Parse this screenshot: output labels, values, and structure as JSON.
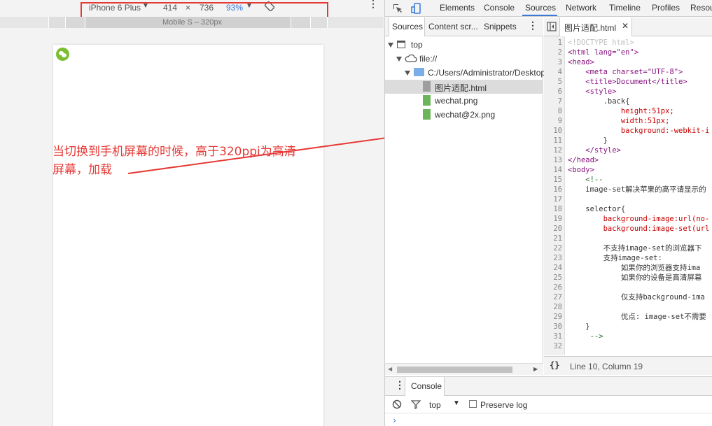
{
  "device_toolbar": {
    "device_name": "iPhone 6 Plus",
    "width": "414",
    "times": "×",
    "height": "736",
    "zoom": "93%"
  },
  "media_query_bar": {
    "label": "Mobile S – 320px"
  },
  "annotation": {
    "line1": "当切换到手机屏幕的时候，高于320ppi为高清",
    "line2": "屏幕，加载"
  },
  "devtools_tabs": [
    "Elements",
    "Console",
    "Sources",
    "Network",
    "Timeline",
    "Profiles",
    "Resou"
  ],
  "active_devtools_tab": "Sources",
  "navigator": {
    "tabs": [
      "Sources",
      "Content scr...",
      "Snippets"
    ],
    "tree": [
      {
        "label": "top"
      },
      {
        "label": "file://"
      },
      {
        "label": "C:/Users/Administrator/Desktop"
      },
      {
        "label": "图片适配.html"
      },
      {
        "label": "wechat.png"
      },
      {
        "label": "wechat@2x.png"
      }
    ]
  },
  "editor": {
    "file_tab": "图片适配.html",
    "status": "Line 10, Column 19",
    "line_numbers": [
      "1",
      "2",
      "3",
      "4",
      "5",
      "6",
      "7",
      "8",
      "9",
      "10",
      "11",
      "12",
      "13",
      "14",
      "15",
      "16",
      "17",
      "18",
      "19",
      "20",
      "21",
      "22",
      "23",
      "24",
      "25",
      "26",
      "27",
      "28",
      "29",
      "30",
      "31",
      "32"
    ],
    "code": [
      "<!DOCTYPE html>",
      "<html lang=\"en\">",
      "<head>",
      "    <meta charset=\"UTF-8\">",
      "    <title>Document</title>",
      "    <style>",
      "        .back{",
      "            height:51px;",
      "            width:51px;",
      "            background:-webkit-i",
      "        }",
      "    </style>",
      "</head>",
      "<body>",
      "    <!--",
      "    image-set解决苹果的高平请显示的",
      "",
      "    selector{",
      "        background-image:url(no-",
      "        background:image-set(url",
      "",
      "        不支持image-set的浏览器下",
      "        支持image-set:",
      "            如果你的浏览器支持ima",
      "            如果你的设备是高清屏幕",
      "",
      "            仅支持background-ima",
      "",
      "            优点: image-set不需要",
      "    }",
      "     -->",
      ""
    ]
  },
  "console": {
    "tab": "Console",
    "context": "top",
    "preserve_log": "Preserve log",
    "prompt": "›"
  },
  "colors": {
    "accent": "#3879d9",
    "annotation": "#e53935",
    "wechat": "#7cbe32"
  }
}
